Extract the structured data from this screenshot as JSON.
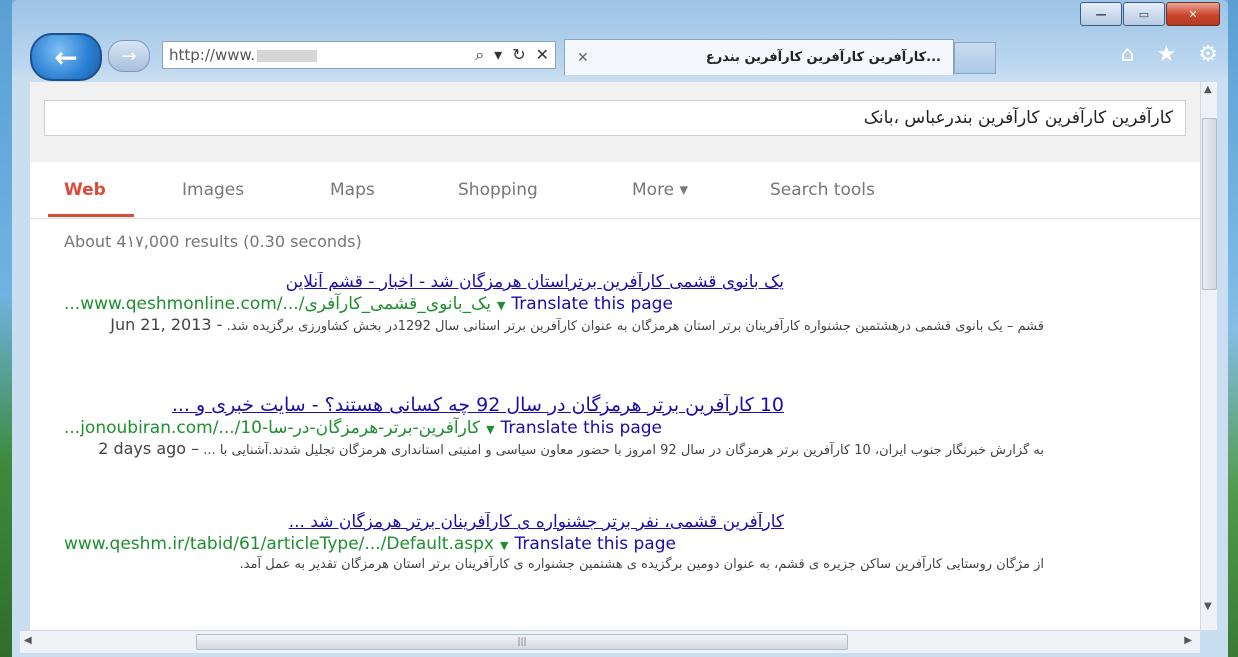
{
  "browser": {
    "address": "http://www.",
    "tab_title": "...کارآفرین کارآفرین کارآفرین بندرع",
    "caption": {
      "minimize": "—",
      "maximize": "▭",
      "close": "✕"
    }
  },
  "search": {
    "query": "کارآفرین کارآفرین کارآفرین بندرعباس ،بانک"
  },
  "tabs": [
    {
      "label": "Web"
    },
    {
      "label": "Images"
    },
    {
      "label": "Maps"
    },
    {
      "label": "Shopping"
    },
    {
      "label": "More ▾"
    },
    {
      "label": "Search tools"
    }
  ],
  "stats": "About 4۱۷,000 results (0.30 seconds)",
  "results": [
    {
      "title": "یک بانوی قشمی کارآفرین برتراستان هرمزگان شد - اخبار - قشم آنلاین",
      "url": "...www.qeshmonline.com/.../یک_بانوی_قشمی_کارآفری",
      "translate": "Translate this page",
      "snippet": "قشم – یک بانوی قشمی درهشتمین جشنواره کارآفرینان برتر استان هرمزگان به عنوان کارآفرین برتر استانی سال 1292در بخش کشاورزی برگزیده شد.",
      "date": "Jun 21, 2013 -"
    },
    {
      "title": "10 کارآفرین برتر هرمزگان در سال 92 چه کسانی هستند؟ - سایت خبری و ...",
      "url": "...jonoubiran.com/.../10-کارآفرین-برتر-هرمزگان-در-سا",
      "translate": "Translate this page",
      "snippet": "به گزارش خبرنگار جنوب ایران، 10 کارآفرین برتر هرمزگان در سال 92 امروز با حضور معاون سیاسی و امنیتی استانداری هرمزگان تجلیل شدند.آشنایی با ...",
      "date": "2 days ago –"
    },
    {
      "title": "کارآفرین قشمی، نفر برتر جشنواره ی کارآفرینان برتر هرمزگان شد ...",
      "url": "www.qeshm.ir/tabid/61/articleType/.../Default.aspx",
      "translate": "Translate this page",
      "snippet": "از مژگان روستایی کارآفرین ساکن جزیره ی قشم، به عنوان دومین برگزیده ی هشتمین جشنواره ی کارآفرینان برتر استان هرمزگان تقدیر به عمل آمد."
    }
  ],
  "icons": {
    "back": "arrow-left-icon",
    "forward": "arrow-right-icon",
    "search": "magnifier-icon",
    "refresh": "refresh-icon",
    "stop": "close-icon",
    "home": "home-icon",
    "favorites": "star-icon",
    "tools": "gear-icon"
  },
  "colors": {
    "link": "#1a0dab",
    "url": "#1e8f2e",
    "active_tab": "#dd4b39"
  }
}
